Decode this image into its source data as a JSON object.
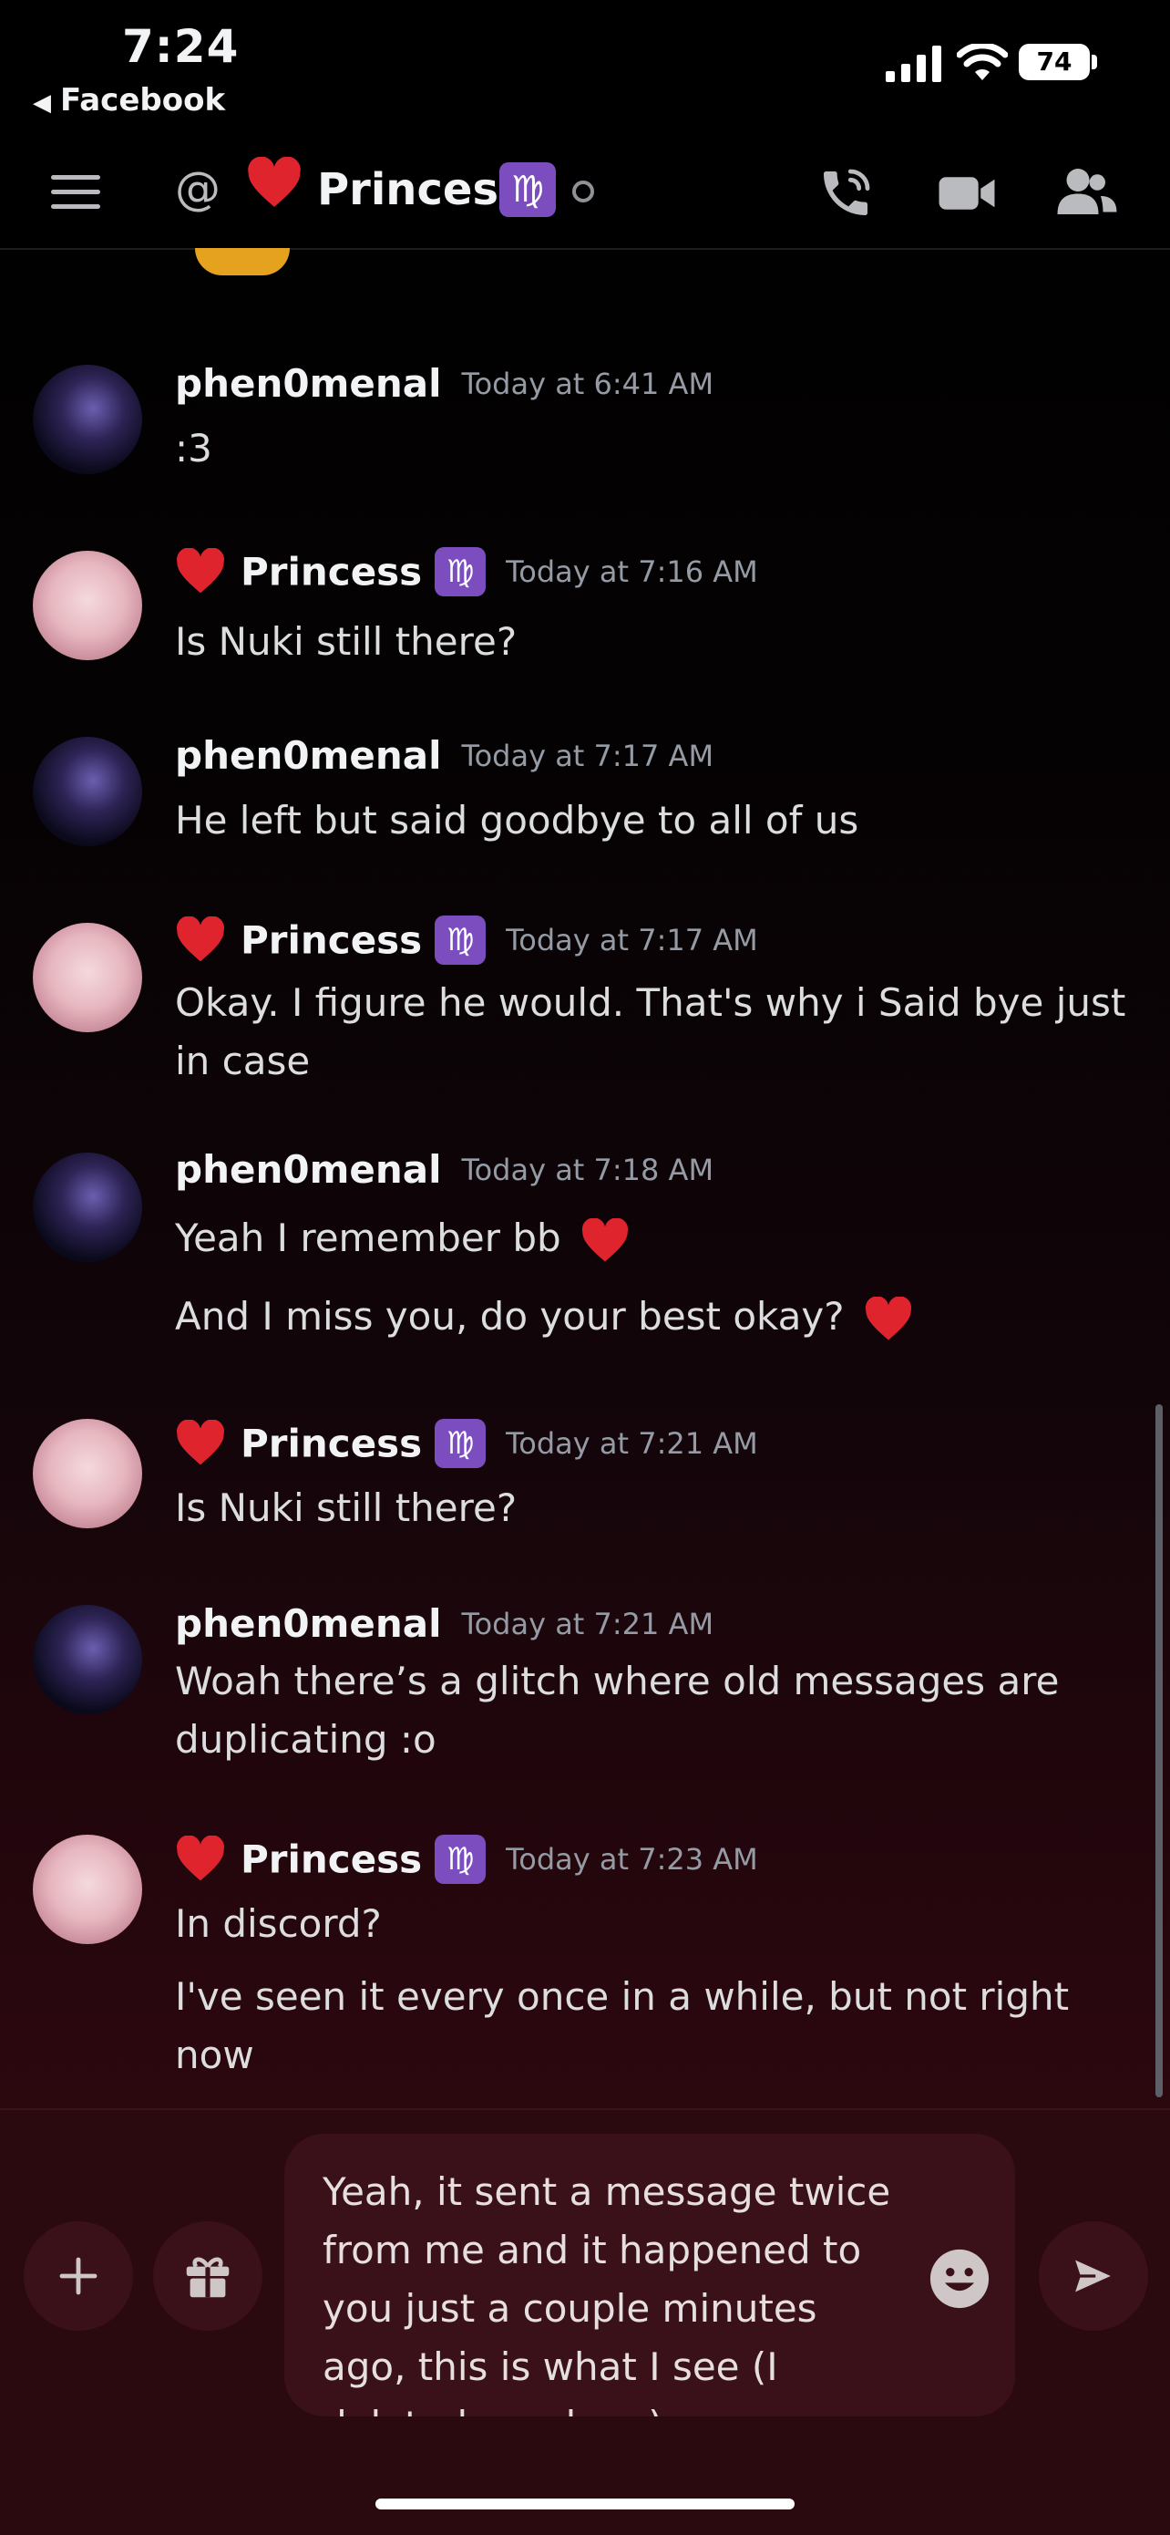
{
  "status_bar": {
    "time": "7:24",
    "back_label": "Facebook",
    "battery": "74"
  },
  "header": {
    "channel_name": "Princess",
    "virgo_symbol": "♍",
    "icons": [
      "menu-icon",
      "at-icon",
      "call-icon",
      "video-icon",
      "members-icon"
    ]
  },
  "messages": [
    {
      "author": "phen0menal",
      "timestamp": "Today at 6:41 AM",
      "lines": [
        ":3"
      ]
    },
    {
      "author": "Princess",
      "timestamp": "Today at 7:16 AM",
      "lines": [
        "Is Nuki still there?"
      ]
    },
    {
      "author": "phen0menal",
      "timestamp": "Today at 7:17 AM",
      "lines": [
        "He left but said goodbye to all of us"
      ]
    },
    {
      "author": "Princess",
      "timestamp": "Today at 7:17 AM",
      "lines": [
        "Okay. I figure he would. That's why i Said bye just in case"
      ]
    },
    {
      "author": "phen0menal",
      "timestamp": "Today at 7:18 AM",
      "lines": [
        "Yeah I remember bb",
        "And I miss you, do your best okay?"
      ]
    },
    {
      "author": "Princess",
      "timestamp": "Today at 7:21 AM",
      "lines": [
        "Is Nuki still there?"
      ]
    },
    {
      "author": "phen0menal",
      "timestamp": "Today at 7:21 AM",
      "lines": [
        "Woah there’s a glitch where old messages are duplicating :o"
      ]
    },
    {
      "author": "Princess",
      "timestamp": "Today at 7:23 AM",
      "lines": [
        "In discord?",
        "I've seen it every once in a while, but not right now"
      ]
    }
  ],
  "composer": {
    "draft_text": "Yeah, it sent a message twice from me and it happened to you just a couple minutes ago, this is what I see (I deleted my dupe)"
  }
}
